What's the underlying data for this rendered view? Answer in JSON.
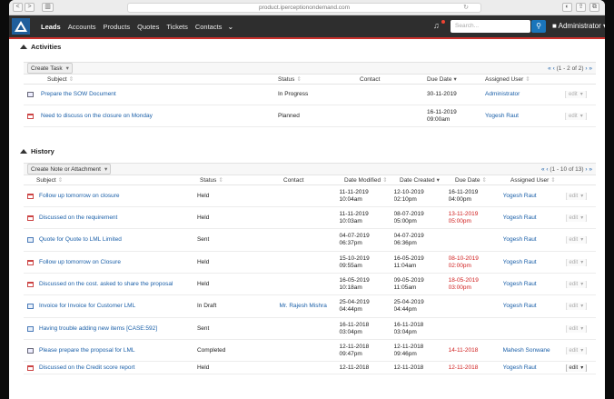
{
  "browser": {
    "url": "product.iperceptionondemand.com",
    "nav_back": "<",
    "nav_fwd": ">",
    "sidebar": "▥",
    "reload": "↻",
    "right_icons": [
      "◐",
      "⇪",
      "⧉"
    ]
  },
  "appbar": {
    "menu": [
      "Leads",
      "Accounts",
      "Products",
      "Quotes",
      "Tickets",
      "Contacts"
    ],
    "more": "⌄",
    "search_placeholder": "Search...",
    "user": "Administrator"
  },
  "activities": {
    "title": "Activities",
    "create_button": "Create Task",
    "pager": "(1 - 2 of 2)",
    "headers": [
      "Subject",
      "Status",
      "Contact",
      "Due Date",
      "Assigned User"
    ],
    "rows": [
      {
        "icon": "task",
        "subject": "Prepare the SOW Document",
        "status": "In Progress",
        "contact": "",
        "due": "30-11-2019",
        "due_time": "",
        "assigned": "Administrator",
        "edit": "edit"
      },
      {
        "icon": "cal",
        "subject": "Need to discuss on the closure on Monday",
        "status": "Planned",
        "contact": "",
        "due": "16-11-2019",
        "due_time": "09:00am",
        "assigned": "Yogesh Raut",
        "edit": "edit"
      }
    ]
  },
  "history": {
    "title": "History",
    "create_button": "Create Note or Attachment",
    "pager": "(1 - 10 of 13)",
    "headers": [
      "Subject",
      "Status",
      "Contact",
      "Date Modified",
      "Date Created",
      "Due Date",
      "Assigned User"
    ],
    "rows": [
      {
        "icon": "cal",
        "subject": "Follow up tomorrow on closure",
        "status": "Held",
        "contact": "",
        "mod": "11-11-2019",
        "mod_t": "10:04am",
        "cre": "12-10-2019",
        "cre_t": "02:10pm",
        "due": "16-11-2019",
        "due_t": "04:00pm",
        "due_red": false,
        "assigned": "Yogesh Raut",
        "edit": "edit"
      },
      {
        "icon": "cal",
        "subject": "Discussed on the requirement",
        "status": "Held",
        "contact": "",
        "mod": "11-11-2019",
        "mod_t": "10:03am",
        "cre": "08-07-2019",
        "cre_t": "05:00pm",
        "due": "13-11-2019",
        "due_t": "05:00pm",
        "due_red": true,
        "assigned": "Yogesh Raut",
        "edit": "edit"
      },
      {
        "icon": "mail",
        "subject": "Quote for Quote to LML Limited",
        "status": "Sent",
        "contact": "",
        "mod": "04-07-2019",
        "mod_t": "06:37pm",
        "cre": "04-07-2019",
        "cre_t": "06:36pm",
        "due": "",
        "due_t": "",
        "due_red": false,
        "assigned": "Yogesh Raut",
        "edit": "edit"
      },
      {
        "icon": "cal",
        "subject": "Follow up tomorrow on Closure",
        "status": "Held",
        "contact": "",
        "mod": "15-10-2019",
        "mod_t": "09:55am",
        "cre": "16-05-2019",
        "cre_t": "11:04am",
        "due": "08-10-2019",
        "due_t": "02:00pm",
        "due_red": true,
        "assigned": "Yogesh Raut",
        "edit": "edit"
      },
      {
        "icon": "cal",
        "subject": "Discussed on the cost. asked to share the proposal",
        "status": "Held",
        "contact": "",
        "mod": "16-05-2019",
        "mod_t": "10:18am",
        "cre": "09-05-2019",
        "cre_t": "11:05am",
        "due": "18-05-2019",
        "due_t": "03:00pm",
        "due_red": true,
        "assigned": "Yogesh Raut",
        "edit": "edit"
      },
      {
        "icon": "mail",
        "subject": "Invoice for Invoice for Customer LML",
        "status": "In Draft",
        "contact": "Mr. Rajesh Mishra",
        "mod": "25-04-2019",
        "mod_t": "04:44pm",
        "cre": "25-04-2019",
        "cre_t": "04:44pm",
        "due": "",
        "due_t": "",
        "due_red": false,
        "assigned": "Yogesh Raut",
        "edit": "edit"
      },
      {
        "icon": "mail",
        "subject": "Having trouble adding new items [CASE:592]",
        "status": "Sent",
        "contact": "",
        "mod": "16-11-2018",
        "mod_t": "03:04pm",
        "cre": "16-11-2018",
        "cre_t": "03:04pm",
        "due": "",
        "due_t": "",
        "due_red": false,
        "assigned": "",
        "edit": "edit"
      },
      {
        "icon": "task",
        "subject": "Please prepare the proposal for LML",
        "status": "Completed",
        "contact": "",
        "mod": "12-11-2018",
        "mod_t": "09:47pm",
        "cre": "12-11-2018",
        "cre_t": "09:46pm",
        "due": "14-11-2018",
        "due_t": "",
        "due_red": true,
        "assigned": "Mahesh Sonwane",
        "edit": "edit"
      },
      {
        "icon": "cal",
        "subject": "Discussed on the Credit score report",
        "status": "Held",
        "contact": "",
        "mod": "12-11-2018",
        "mod_t": "",
        "cre": "12-11-2018",
        "cre_t": "",
        "due": "12-11-2018",
        "due_t": "",
        "due_red": true,
        "assigned": "Yogesh Raut",
        "edit": "edit"
      }
    ]
  }
}
